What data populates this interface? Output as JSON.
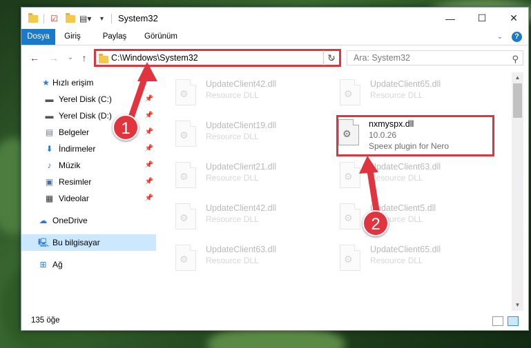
{
  "window": {
    "title": "System32",
    "controls": {
      "minimize": "—",
      "maximize": "☐",
      "close": "✕"
    }
  },
  "ribbon": {
    "tabs": [
      "Dosya",
      "Giriş",
      "Paylaş",
      "Görünüm"
    ],
    "help": "?"
  },
  "nav": {
    "back": "←",
    "forward": "→",
    "recent": "⌄",
    "up": "↑",
    "address": "C:\\Windows\\System32",
    "search_placeholder": "Ara: System32"
  },
  "sidebar": {
    "items": [
      {
        "label": "Hızlı erişim",
        "icon": "star-icon"
      },
      {
        "label": "Yerel Disk (C:)",
        "icon": "drive-icon",
        "pinned": true
      },
      {
        "label": "Yerel Disk (D:)",
        "icon": "drive-icon",
        "pinned": true
      },
      {
        "label": "Belgeler",
        "icon": "document-icon",
        "pinned": true
      },
      {
        "label": "İndirmeler",
        "icon": "download-icon",
        "pinned": true
      },
      {
        "label": "Müzik",
        "icon": "music-icon",
        "pinned": true
      },
      {
        "label": "Resimler",
        "icon": "picture-icon",
        "pinned": true
      },
      {
        "label": "Videolar",
        "icon": "video-icon",
        "pinned": true
      },
      {
        "label": "OneDrive",
        "icon": "cloud-icon"
      },
      {
        "label": "Bu bilgisayar",
        "icon": "computer-icon",
        "selected": true
      },
      {
        "label": "Ağ",
        "icon": "network-icon"
      }
    ]
  },
  "files": [
    {
      "name": "UpdateClient42.dll",
      "desc": "Resource DLL"
    },
    {
      "name": "UpdateClient65.dll",
      "desc": "Resource DLL"
    },
    {
      "name": "UpdateClient19.dll",
      "desc": "Resource DLL"
    },
    {
      "name": "nxmyspx.dll",
      "desc": "10.0.26",
      "desc2": "Speex plugin for Nero"
    },
    {
      "name": "UpdateClient21.dll",
      "desc": "Resource DLL"
    },
    {
      "name": "UpdateClient63.dll",
      "desc": "Resource DLL"
    },
    {
      "name": "UpdateClient42.dll",
      "desc": "Resource DLL"
    },
    {
      "name": "UpdateClient5.dll",
      "desc": "Resource DLL"
    },
    {
      "name": "UpdateClient63.dll",
      "desc": "Resource DLL"
    },
    {
      "name": "UpdateClient65.dll",
      "desc": "Resource DLL"
    }
  ],
  "status": {
    "count": "135 öğe"
  },
  "annotations": {
    "step1": "1",
    "step2": "2",
    "color": "#e0353f"
  }
}
